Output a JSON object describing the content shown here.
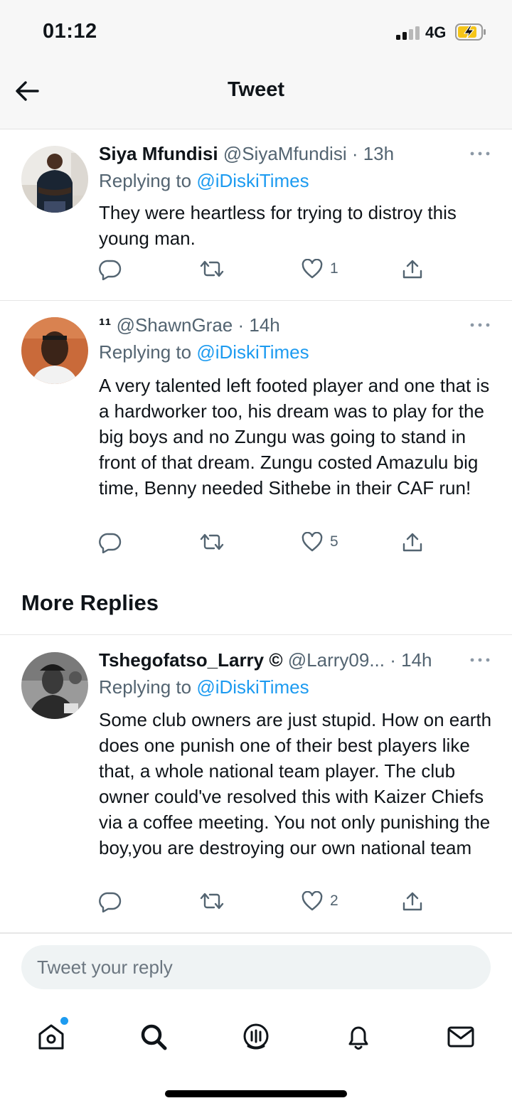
{
  "status_bar": {
    "time": "01:12",
    "network": "4G",
    "battery_charging": true
  },
  "header": {
    "title": "Tweet"
  },
  "tweets": [
    {
      "name": "Siya Mfundisi",
      "handle": "@SiyaMfundisi",
      "time": "· 13h",
      "replying_prefix": "Replying to",
      "replying_to": "@iDiskiTimes",
      "text": "They were heartless for trying to distroy this young man.",
      "likes": "1"
    },
    {
      "name": "¹¹",
      "handle": "@ShawnGrae",
      "time": "· 14h",
      "replying_prefix": "Replying to",
      "replying_to": "@iDiskiTimes",
      "text": "A very talented left footed player and one that is a hardworker too, his dream was to play for the big boys and no Zungu was going to stand in front of that dream. Zungu costed Amazulu big time, Benny needed Sithebe in their CAF run!",
      "likes": "5"
    }
  ],
  "more_replies": {
    "title": "More Replies",
    "tweets": [
      {
        "name": "Tshegofatso_Larry",
        "name_symbol": "©",
        "handle": "@Larry09...",
        "time": "· 14h",
        "replying_prefix": "Replying to",
        "replying_to": "@iDiskiTimes",
        "text": "Some club owners are just stupid. How on earth does one punish one of their best players like that, a whole national team player. The club owner could've resolved this with Kaizer Chiefs via a coffee meeting. You not only punishing the boy,you are destroying our own national team",
        "likes": "2"
      }
    ]
  },
  "reply_box": {
    "placeholder": "Tweet your reply"
  },
  "bottom_nav": {
    "items": [
      "home-icon",
      "search-icon",
      "spaces-icon",
      "notifications-icon",
      "messages-icon"
    ],
    "home_has_notification": true
  },
  "colors": {
    "accent": "#1d9bf0",
    "text": "#0f1419",
    "secondary": "#536471"
  }
}
